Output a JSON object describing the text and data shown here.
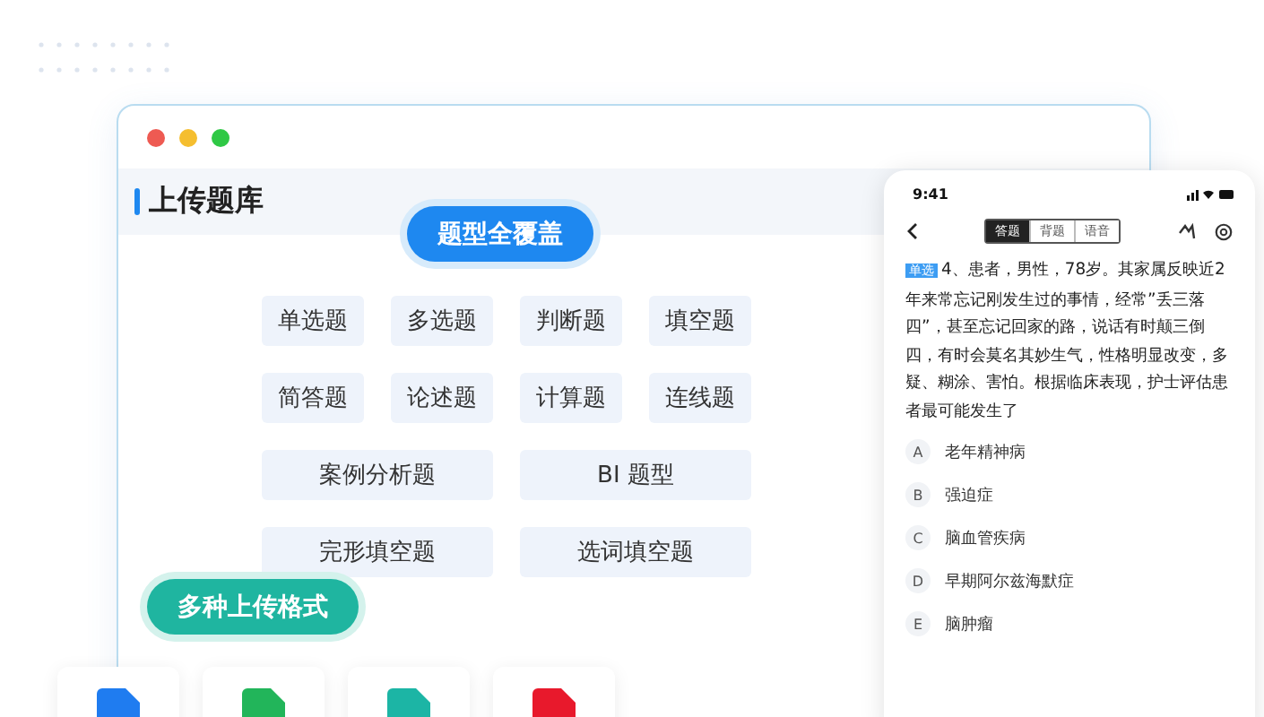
{
  "window": {
    "title": "上传题库"
  },
  "badges": [
    {
      "label": "题型全覆盖",
      "kind": "types"
    },
    {
      "label": "多种上传格式",
      "kind": "formats"
    }
  ],
  "question_types": [
    {
      "label": "单选题",
      "kind": "small"
    },
    {
      "label": "多选题",
      "kind": "small"
    },
    {
      "label": "判断题",
      "kind": "small"
    },
    {
      "label": "填空题",
      "kind": "small"
    },
    {
      "label": "简答题",
      "kind": "small"
    },
    {
      "label": "论述题",
      "kind": "small"
    },
    {
      "label": "计算题",
      "kind": "small"
    },
    {
      "label": "连线题",
      "kind": "small"
    },
    {
      "label": "案例分析题",
      "kind": "wide"
    },
    {
      "label": "BI 题型",
      "kind": "wide"
    },
    {
      "label": "完形填空题",
      "kind": "wide"
    },
    {
      "label": "选词填空题",
      "kind": "wide"
    }
  ],
  "file_formats": [
    {
      "color": "#1f7cf0"
    },
    {
      "color": "#22b55a"
    },
    {
      "color": "#1cb5a5"
    },
    {
      "color": "#e8192c"
    }
  ],
  "phone": {
    "time": "9:41",
    "tabs": [
      {
        "label": "答题",
        "selected": true
      },
      {
        "label": "背题",
        "selected": false
      },
      {
        "label": "语音",
        "selected": false
      }
    ],
    "question": {
      "tag": "单选",
      "text": "4、患者，男性，78岁。其家属反映近2年来常忘记刚发生过的事情，经常”丢三落四”，甚至忘记回家的路，说话有时颠三倒四，有时会莫名其妙生气，性格明显改变，多疑、糊涂、害怕。根据临床表现，护士评估患者最可能发生了"
    },
    "options": [
      {
        "letter": "A",
        "text": "老年精神病"
      },
      {
        "letter": "B",
        "text": "强迫症"
      },
      {
        "letter": "C",
        "text": "脑血管疾病"
      },
      {
        "letter": "D",
        "text": "早期阿尔兹海默症"
      },
      {
        "letter": "E",
        "text": "脑肿瘤"
      }
    ]
  }
}
